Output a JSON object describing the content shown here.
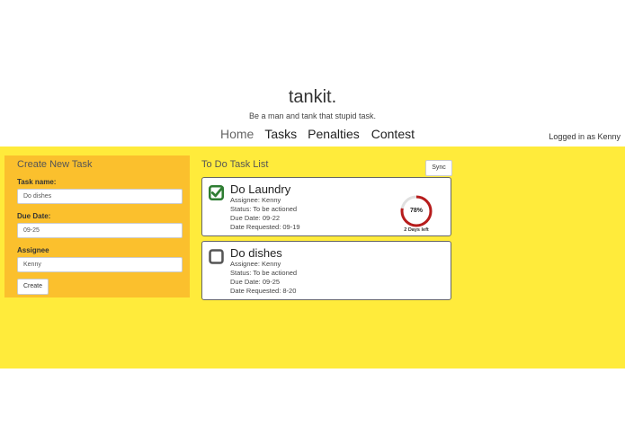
{
  "brand": {
    "title": "tankit.",
    "tagline": "Be a man and tank that stupid task."
  },
  "nav": {
    "items": [
      "Home",
      "Tasks",
      "Penalties",
      "Contest"
    ],
    "logged_in": "Logged in as Kenny"
  },
  "create": {
    "title": "Create New Task",
    "task_name_label": "Task name:",
    "task_name_value": "Do dishes",
    "due_date_label": "Due Date:",
    "due_date_value": "09-25",
    "assignee_label": "Assignee",
    "assignee_value": "Kenny",
    "create_label": "Create"
  },
  "todo": {
    "title": "To Do Task List",
    "sync_label": "Sync",
    "tasks": [
      {
        "title": "Do Laundry",
        "assignee": "Assignee: Kenny",
        "status": "Status: To be actioned",
        "due": "Due Date: 09-22",
        "requested": "Date Requested: 09-19",
        "checked": true,
        "progress_percent": 78,
        "progress_label": "78%",
        "days_left": "2 Days left"
      },
      {
        "title": "Do dishes",
        "assignee": "Assignee: Kenny",
        "status": "Status: To be actioned",
        "due": "Due Date: 09-25",
        "requested": "Date Requested: 8-20",
        "checked": false
      }
    ]
  },
  "colors": {
    "band": "#ffeb3b",
    "panel": "#fbc02d",
    "check": "#2e7d32",
    "progress": "#b71c1c"
  }
}
